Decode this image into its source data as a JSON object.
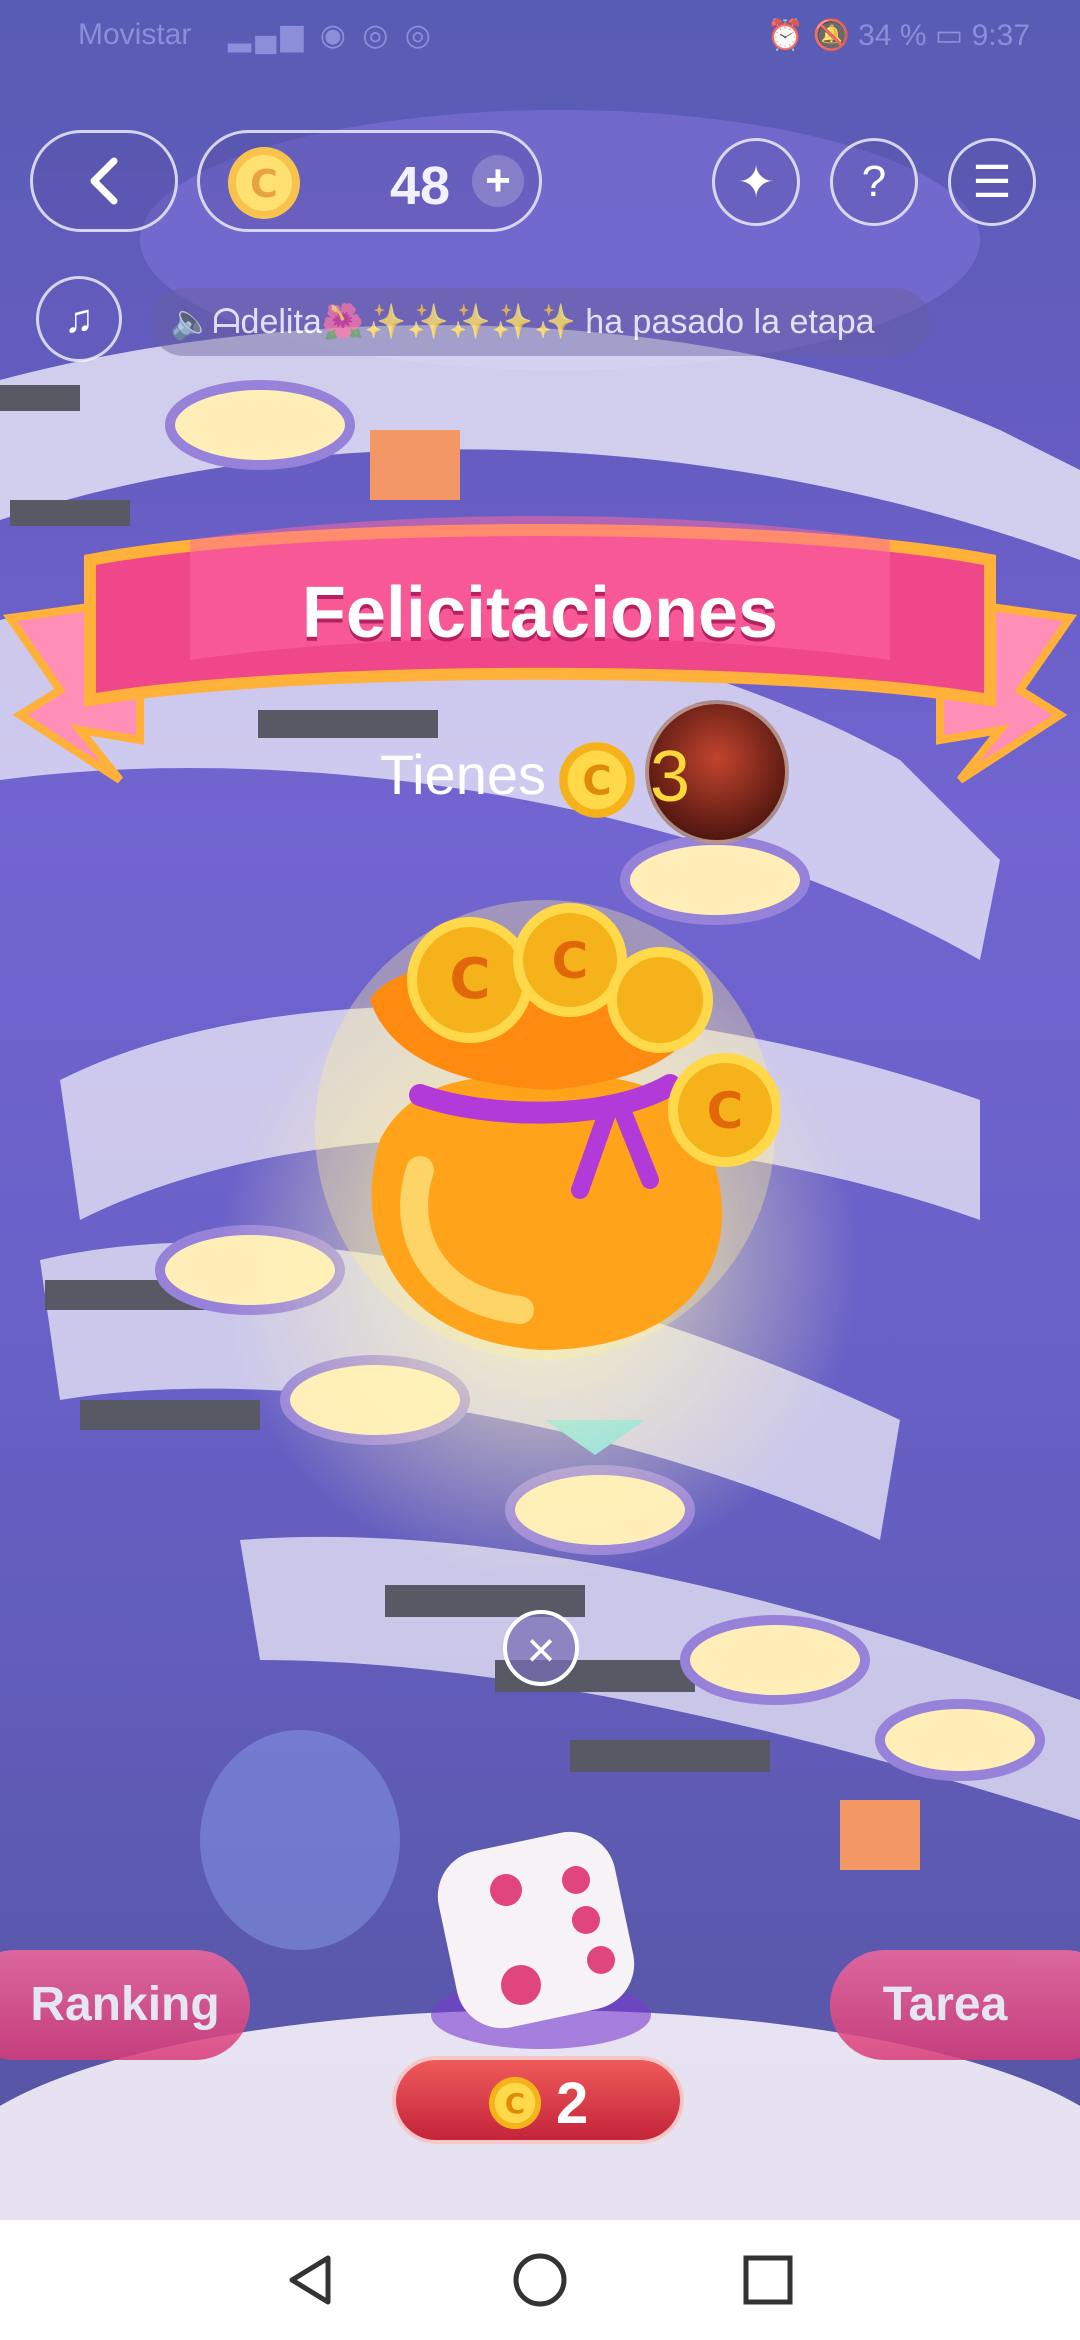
{
  "status_bar": {
    "carrier": "Movistar",
    "battery": "34 %",
    "time": "9:37"
  },
  "header": {
    "coins": "48",
    "add_label": "+"
  },
  "ticker": {
    "text": "🔈ᗩdelita🌺✨✨✨✨✨ ha pasado la etapa"
  },
  "reward_popup": {
    "title": "Felicitaciones",
    "you_have_label": "Tienes",
    "amount": "3"
  },
  "bottom": {
    "ranking_label": "Ranking",
    "task_label": "Tarea",
    "roll_cost": "2"
  },
  "colors": {
    "background": "#3a2fb0",
    "ribbon": "#f0478a",
    "ribbon_border": "#ffb13a",
    "accent_yellow": "#ffd83a",
    "button_pink": "#e04d84"
  },
  "icons": [
    "back-icon",
    "coin-icon",
    "plus-icon",
    "magic-wand-icon",
    "help-icon",
    "menu-icon",
    "music-icon",
    "close-icon",
    "dice-icon",
    "coin-bag-icon"
  ]
}
